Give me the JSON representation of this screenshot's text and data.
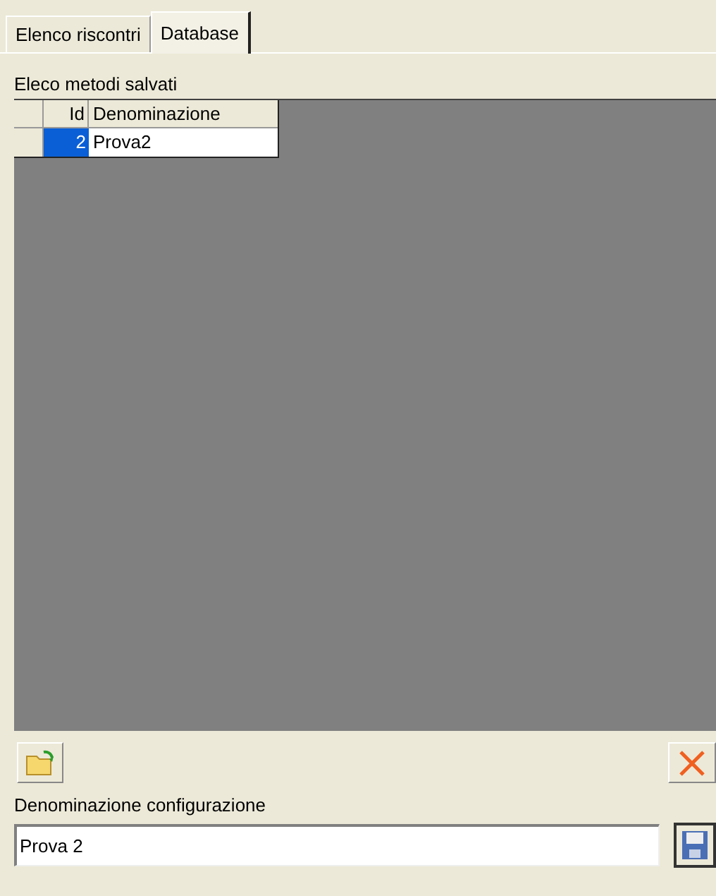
{
  "tabs": [
    {
      "label": "Elenco riscontri",
      "selected": false
    },
    {
      "label": "Database",
      "selected": true
    }
  ],
  "saved_methods": {
    "label": "Eleco metodi salvati",
    "table": {
      "columns": [
        "Id",
        "Denominazione"
      ],
      "rows": [
        {
          "cells": [
            "2",
            "Prova2"
          ],
          "selected": true
        }
      ]
    }
  },
  "configuration": {
    "label": "Denominazione configurazione",
    "value": "Prova 2"
  }
}
